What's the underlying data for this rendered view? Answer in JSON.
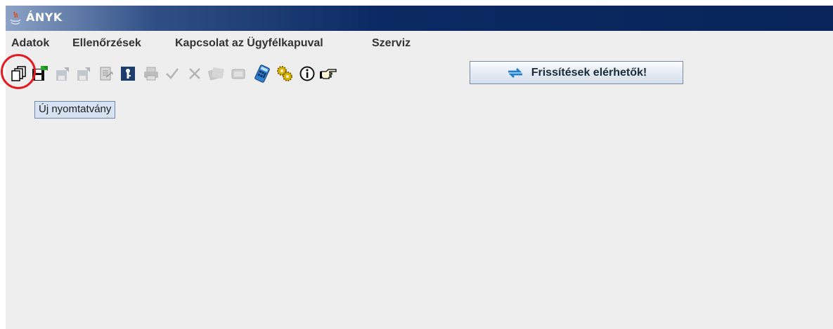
{
  "window": {
    "title": "ÁNYK"
  },
  "menu": [
    "Adatok",
    "Ellenőrzések",
    "Kapcsolat az Ügyfélkapuval",
    "Szerviz"
  ],
  "toolbar": {
    "icons": [
      "new-form-icon",
      "save-icon",
      "edit-disabled-icon",
      "edit2-disabled-icon",
      "import-disabled-icon",
      "key-icon",
      "print-disabled-icon",
      "check-disabled-icon",
      "delete-disabled-icon",
      "attachment-disabled-icon",
      "form-disabled-icon",
      "calculator-icon",
      "settings-gears-icon",
      "info-icon",
      "pointing-hand-icon"
    ],
    "update_button_label": "Frissítések elérhetők!"
  },
  "tooltip": {
    "text": "Új nyomtatvány"
  },
  "colors": {
    "highlight": "#e31b23",
    "titlebar": "#08245a",
    "tooltip_bg": "#d7e3f3"
  }
}
